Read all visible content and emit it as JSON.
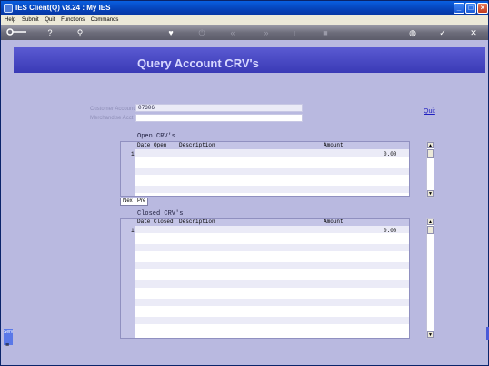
{
  "window": {
    "title": "IES Client(Q) v8.24 : My IES"
  },
  "menu": [
    "Help",
    "Submit",
    "Quit",
    "Functions",
    "Commands"
  ],
  "toolbar": {
    "icons": [
      "key-icon",
      "help-icon",
      "search-icon",
      "heart-icon",
      "power-icon",
      "rewind-icon",
      "fast-forward-icon",
      "info-icon",
      "stop-icon",
      "globe-icon",
      "check-icon",
      "close-icon"
    ]
  },
  "page": {
    "title": "Query Account CRV's"
  },
  "form": {
    "customer_account_label": "Customer Account",
    "customer_account_value": "07306",
    "merchandise_acct_label": "Merchandise Acct",
    "merchandise_acct_value": "",
    "quit_label": "Quit"
  },
  "open_grid": {
    "title": "Open CRV's",
    "headers": {
      "date": "Date Open",
      "description": "Description",
      "amount": "Amount"
    },
    "row_number": "1",
    "row_amount": "0.00"
  },
  "nav": {
    "next": "Nex",
    "prev": "Pre"
  },
  "closed_grid": {
    "title": "Closed CRV's",
    "headers": {
      "date": "Date Closed",
      "description": "Description",
      "amount": "Amount"
    },
    "row_number": "1",
    "row_amount": "0.00"
  },
  "side": {
    "tab": "Serv",
    "marker": "≡"
  }
}
